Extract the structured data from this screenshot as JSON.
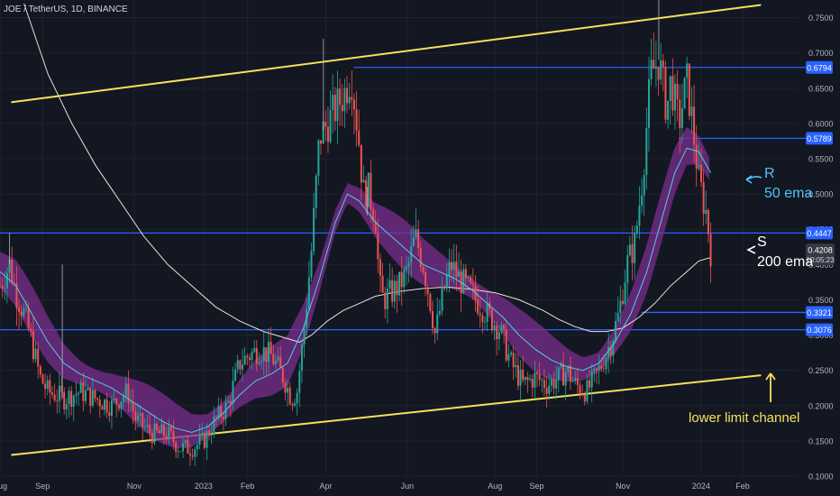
{
  "header": {
    "symbol_title": "JOE / TetherUS, 1D, BINANCE"
  },
  "chart_data": {
    "type": "candlestick",
    "y_axis": {
      "min": 0.1,
      "max": 0.775,
      "ticks": [
        "0.1000",
        "0.1500",
        "0.2000",
        "0.2500",
        "0.3000",
        "0.3500",
        "0.4000",
        "0.4500",
        "0.5000",
        "0.5500",
        "0.6000",
        "0.6500",
        "0.7000",
        "0.7500"
      ]
    },
    "x_axis": {
      "ticks": [
        {
          "label": "Aug",
          "pos": 0.0
        },
        {
          "label": "Sep",
          "pos": 0.0533
        },
        {
          "label": "Nov",
          "pos": 0.168
        },
        {
          "label": "2023",
          "pos": 0.255
        },
        {
          "label": "Feb",
          "pos": 0.31
        },
        {
          "label": "Apr",
          "pos": 0.408
        },
        {
          "label": "Jun",
          "pos": 0.51
        },
        {
          "label": "Aug",
          "pos": 0.62
        },
        {
          "label": "Sep",
          "pos": 0.672
        },
        {
          "label": "Nov",
          "pos": 0.78
        },
        {
          "label": "2024",
          "pos": 0.878
        },
        {
          "label": "Feb",
          "pos": 0.93
        }
      ]
    },
    "horizontal_levels": [
      {
        "value": 0.6794,
        "label": "0.6794",
        "start": 0.443
      },
      {
        "value": 0.5789,
        "label": "0.5789",
        "start": 0.85
      },
      {
        "value": 0.4447,
        "label": "0.4447",
        "start": 0.0
      },
      {
        "value": 0.3321,
        "label": "0.3321",
        "start": 0.803
      },
      {
        "value": 0.3076,
        "label": "0.3076",
        "start": 0.0
      }
    ],
    "current_price": {
      "value": 0.4208,
      "label": "0.4208",
      "countdown": "10:05:23"
    },
    "channel_lines": [
      {
        "name": "upper",
        "from": [
          0.014,
          0.63
        ],
        "to": [
          0.953,
          0.768
        ]
      },
      {
        "name": "lower",
        "from": [
          0.014,
          0.13
        ],
        "to": [
          0.953,
          0.243
        ]
      }
    ],
    "price_path": [
      [
        0.0,
        0.37
      ],
      [
        0.012,
        0.4
      ],
      [
        0.02,
        0.36
      ],
      [
        0.03,
        0.33
      ],
      [
        0.04,
        0.29
      ],
      [
        0.05,
        0.24
      ],
      [
        0.06,
        0.22
      ],
      [
        0.08,
        0.21
      ],
      [
        0.1,
        0.22
      ],
      [
        0.12,
        0.21
      ],
      [
        0.14,
        0.2
      ],
      [
        0.16,
        0.22
      ],
      [
        0.17,
        0.18
      ],
      [
        0.19,
        0.16
      ],
      [
        0.21,
        0.16
      ],
      [
        0.225,
        0.14
      ],
      [
        0.24,
        0.14
      ],
      [
        0.255,
        0.15
      ],
      [
        0.27,
        0.18
      ],
      [
        0.285,
        0.2
      ],
      [
        0.3,
        0.26
      ],
      [
        0.31,
        0.27
      ],
      [
        0.325,
        0.28
      ],
      [
        0.34,
        0.27
      ],
      [
        0.355,
        0.24
      ],
      [
        0.365,
        0.21
      ],
      [
        0.372,
        0.22
      ],
      [
        0.38,
        0.3
      ],
      [
        0.39,
        0.42
      ],
      [
        0.4,
        0.58
      ],
      [
        0.41,
        0.6
      ],
      [
        0.42,
        0.62
      ],
      [
        0.43,
        0.64
      ],
      [
        0.44,
        0.67
      ],
      [
        0.45,
        0.57
      ],
      [
        0.455,
        0.5
      ],
      [
        0.46,
        0.51
      ],
      [
        0.47,
        0.47
      ],
      [
        0.475,
        0.37
      ],
      [
        0.48,
        0.35
      ],
      [
        0.49,
        0.36
      ],
      [
        0.5,
        0.37
      ],
      [
        0.51,
        0.39
      ],
      [
        0.52,
        0.44
      ],
      [
        0.53,
        0.4
      ],
      [
        0.54,
        0.34
      ],
      [
        0.545,
        0.3
      ],
      [
        0.555,
        0.36
      ],
      [
        0.565,
        0.4
      ],
      [
        0.575,
        0.38
      ],
      [
        0.59,
        0.36
      ],
      [
        0.61,
        0.33
      ],
      [
        0.625,
        0.31
      ],
      [
        0.64,
        0.26
      ],
      [
        0.655,
        0.23
      ],
      [
        0.67,
        0.24
      ],
      [
        0.685,
        0.23
      ],
      [
        0.7,
        0.24
      ],
      [
        0.71,
        0.25
      ],
      [
        0.72,
        0.23
      ],
      [
        0.735,
        0.22
      ],
      [
        0.75,
        0.25
      ],
      [
        0.765,
        0.29
      ],
      [
        0.775,
        0.33
      ],
      [
        0.785,
        0.4
      ],
      [
        0.795,
        0.43
      ],
      [
        0.805,
        0.53
      ],
      [
        0.815,
        0.67
      ],
      [
        0.825,
        0.69
      ],
      [
        0.835,
        0.62
      ],
      [
        0.84,
        0.66
      ],
      [
        0.85,
        0.6
      ],
      [
        0.86,
        0.66
      ],
      [
        0.865,
        0.62
      ],
      [
        0.875,
        0.52
      ],
      [
        0.885,
        0.47
      ],
      [
        0.89,
        0.42
      ]
    ],
    "ema200_path": [
      [
        0.03,
        0.77
      ],
      [
        0.06,
        0.67
      ],
      [
        0.09,
        0.6
      ],
      [
        0.12,
        0.54
      ],
      [
        0.15,
        0.49
      ],
      [
        0.18,
        0.44
      ],
      [
        0.21,
        0.4
      ],
      [
        0.24,
        0.37
      ],
      [
        0.27,
        0.34
      ],
      [
        0.3,
        0.32
      ],
      [
        0.33,
        0.305
      ],
      [
        0.36,
        0.295
      ],
      [
        0.375,
        0.29
      ],
      [
        0.39,
        0.3
      ],
      [
        0.41,
        0.32
      ],
      [
        0.43,
        0.335
      ],
      [
        0.45,
        0.345
      ],
      [
        0.47,
        0.355
      ],
      [
        0.5,
        0.362
      ],
      [
        0.53,
        0.366
      ],
      [
        0.56,
        0.368
      ],
      [
        0.59,
        0.365
      ],
      [
        0.62,
        0.36
      ],
      [
        0.65,
        0.35
      ],
      [
        0.68,
        0.335
      ],
      [
        0.7,
        0.322
      ],
      [
        0.72,
        0.312
      ],
      [
        0.74,
        0.305
      ],
      [
        0.76,
        0.305
      ],
      [
        0.78,
        0.31
      ],
      [
        0.8,
        0.325
      ],
      [
        0.82,
        0.345
      ],
      [
        0.84,
        0.37
      ],
      [
        0.86,
        0.39
      ],
      [
        0.875,
        0.405
      ],
      [
        0.89,
        0.41
      ]
    ],
    "ema50_path": [
      [
        0.0,
        0.39
      ],
      [
        0.02,
        0.37
      ],
      [
        0.04,
        0.33
      ],
      [
        0.06,
        0.29
      ],
      [
        0.08,
        0.26
      ],
      [
        0.1,
        0.245
      ],
      [
        0.12,
        0.235
      ],
      [
        0.14,
        0.225
      ],
      [
        0.16,
        0.21
      ],
      [
        0.18,
        0.195
      ],
      [
        0.2,
        0.18
      ],
      [
        0.22,
        0.168
      ],
      [
        0.24,
        0.162
      ],
      [
        0.26,
        0.17
      ],
      [
        0.28,
        0.19
      ],
      [
        0.3,
        0.215
      ],
      [
        0.32,
        0.235
      ],
      [
        0.34,
        0.245
      ],
      [
        0.36,
        0.26
      ],
      [
        0.38,
        0.31
      ],
      [
        0.4,
        0.38
      ],
      [
        0.42,
        0.46
      ],
      [
        0.435,
        0.5
      ],
      [
        0.45,
        0.49
      ],
      [
        0.47,
        0.46
      ],
      [
        0.49,
        0.44
      ],
      [
        0.51,
        0.42
      ],
      [
        0.53,
        0.4
      ],
      [
        0.55,
        0.39
      ],
      [
        0.57,
        0.38
      ],
      [
        0.59,
        0.365
      ],
      [
        0.61,
        0.345
      ],
      [
        0.63,
        0.325
      ],
      [
        0.65,
        0.3
      ],
      [
        0.67,
        0.28
      ],
      [
        0.69,
        0.265
      ],
      [
        0.71,
        0.255
      ],
      [
        0.73,
        0.25
      ],
      [
        0.75,
        0.26
      ],
      [
        0.77,
        0.29
      ],
      [
        0.79,
        0.33
      ],
      [
        0.81,
        0.39
      ],
      [
        0.83,
        0.47
      ],
      [
        0.845,
        0.53
      ],
      [
        0.86,
        0.565
      ],
      [
        0.875,
        0.56
      ],
      [
        0.89,
        0.53
      ]
    ],
    "series": [
      {
        "name": "50 ema"
      },
      {
        "name": "200 ema"
      }
    ]
  },
  "annotations": {
    "resistance_letter": "R",
    "ema50_label": "50 ema",
    "support_letter": "S",
    "ema200_label": "200 ema",
    "lower_limit_label": "lower limit channel"
  },
  "colors": {
    "background": "#131722",
    "grid": "#1e222d",
    "axis_text": "#b2b5be",
    "level_line": "#2962ff",
    "channel": "#f7e15b",
    "ema200": "#e8e4d4",
    "ema_band": "#7b2d8e",
    "ema50": "#4dd0e1",
    "annotation_cyan": "#4fc3f7",
    "annotation_white": "#ffffff",
    "annotation_yellow": "#f7e15b",
    "price_tag_current": "#363a45"
  }
}
